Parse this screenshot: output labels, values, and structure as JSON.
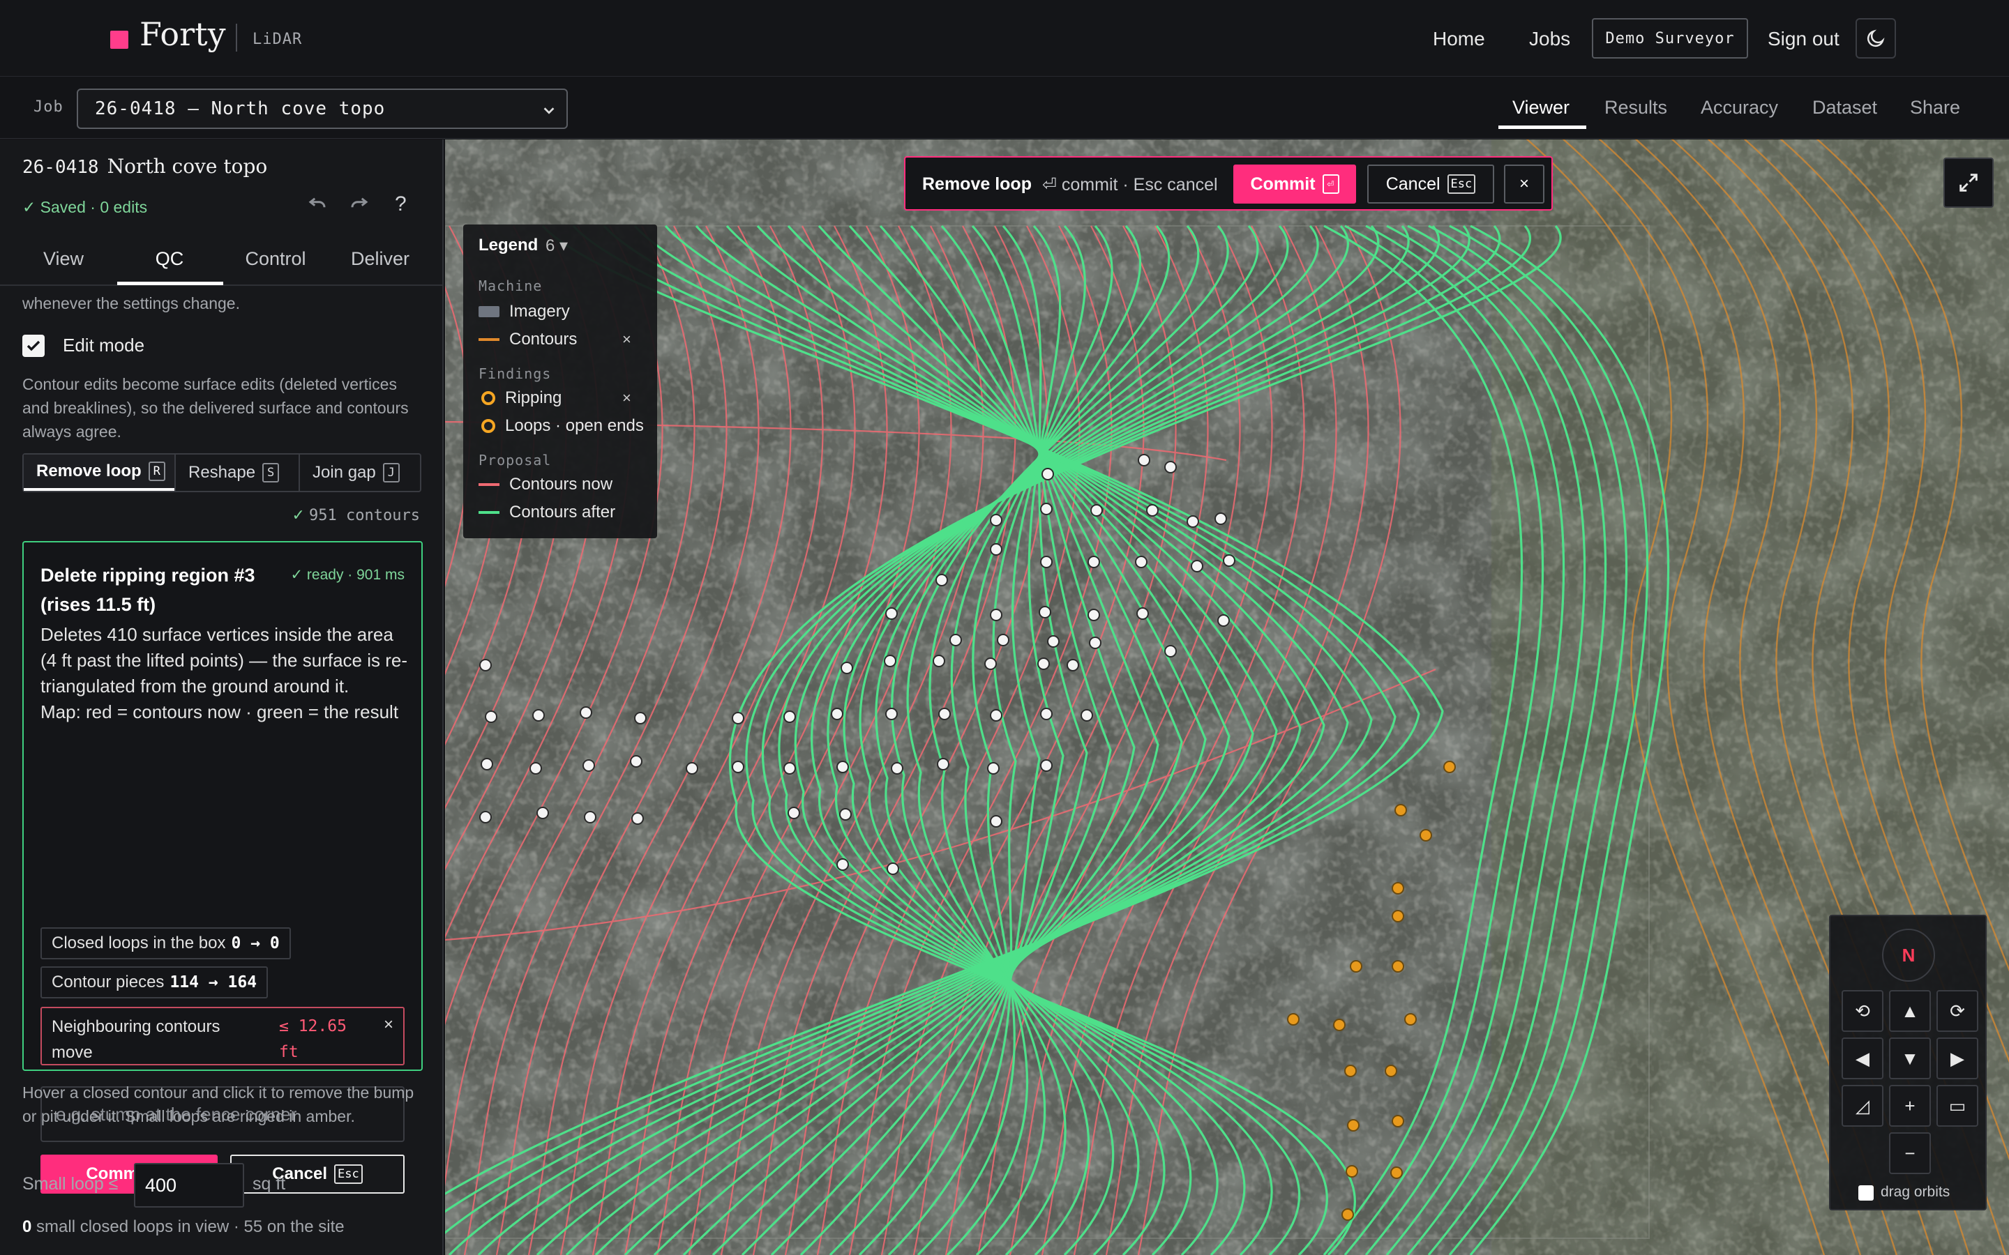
{
  "topbar": {
    "brand": "Forty",
    "product": "LiDAR",
    "nav": [
      "Home",
      "Jobs"
    ],
    "user_button": "Demo Surveyor",
    "sign_out": "Sign out",
    "theme_icon": "moon-icon",
    "brand_color": "#ff3d8b"
  },
  "jobbar": {
    "label": "Job",
    "selected_job": "26-0418 — North cove topo",
    "view_tabs": [
      "Viewer",
      "Results",
      "Accuracy",
      "Dataset",
      "Share"
    ],
    "active_view_tab": "Viewer"
  },
  "sidebar": {
    "job_id": "26-0418",
    "job_name": "North cove topo",
    "saved_status": "✓ Saved · 0 edits",
    "undo_icon": "undo-icon",
    "redo_icon": "redo-icon",
    "help": "?",
    "tabs": [
      "View",
      "QC",
      "Control",
      "Deliver"
    ],
    "active_tab": "QC",
    "scrolled_text": "whenever the settings change.",
    "edit_mode_label": "Edit mode",
    "edit_mode_checked": true,
    "edit_mode_desc": "Contour edits become surface edits (deleted vertices and breaklines), so the delivered surface and contours always agree.",
    "modes": [
      {
        "label": "Remove loop",
        "key": "R"
      },
      {
        "label": "Reshape",
        "key": "S"
      },
      {
        "label": "Join gap",
        "key": "J"
      }
    ],
    "active_mode": "Remove loop",
    "contour_count_check": "✓",
    "contour_count": "951 contours",
    "card": {
      "title": "Delete ripping region #3 (rises 11.5 ft)",
      "status": "✓ ready · 901 ms",
      "description": "Deletes 410 surface vertices inside the area (4 ft past the lifted points) — the surface is re-triangulated from the ground around it.",
      "map_note": "Map: red = contours now · green = the result",
      "stats": [
        {
          "label": "Closed loops in the box",
          "value": "0 → 0"
        },
        {
          "label": "Contour pieces",
          "value": "114 → 164"
        }
      ],
      "warning_label": "Neighbouring contours move",
      "warning_value": "≤ 12.65 ft",
      "warning_close": "×",
      "note_placeholder": "e.g. stump at the fence corner",
      "commit_label": "Commit",
      "commit_key": "⏎",
      "cancel_label": "Cancel",
      "cancel_key": "Esc"
    },
    "hint": "Hover a closed contour and click it to remove the bump or pit under it. Small loops are ringed in amber.",
    "small_loop_label": "Small loop ≤",
    "small_loop_value": "400",
    "small_loop_unit": "sq ft",
    "summary_count": "0",
    "summary_text": " small closed loops in view · 55 on the site"
  },
  "banner": {
    "title": "Remove loop",
    "hint": "⏎ commit · Esc cancel",
    "commit_label": "Commit",
    "commit_key": "⏎",
    "cancel_label": "Cancel",
    "cancel_key": "Esc",
    "close": "×"
  },
  "legend": {
    "title": "Legend",
    "count": "6 ▾",
    "sections": {
      "machine": "Machine",
      "findings": "Findings",
      "proposal": "Proposal"
    },
    "items": {
      "imagery": "Imagery",
      "contours": "Contours",
      "ripping": "Ripping",
      "loops": "Loops · open ends",
      "contours_now": "Contours now",
      "contours_after": "Contours after"
    },
    "remove": "×",
    "colors": {
      "imagery": "#6f7580",
      "contours": "#e0892b",
      "findings": "#f5a623",
      "contours_now": "#f06a72",
      "contours_after": "#4ee08a"
    }
  },
  "navpad": {
    "north": "N",
    "rotate_left": "⟲",
    "up": "▲",
    "rotate_right": "⟳",
    "left": "◀",
    "down": "▼",
    "right": "▶",
    "tilt": "◿",
    "zoom_in": "+",
    "fit": "▭",
    "zoom_out": "−",
    "orbit_label": "drag orbits"
  },
  "map": {
    "expand_icon": "expand-icon"
  }
}
